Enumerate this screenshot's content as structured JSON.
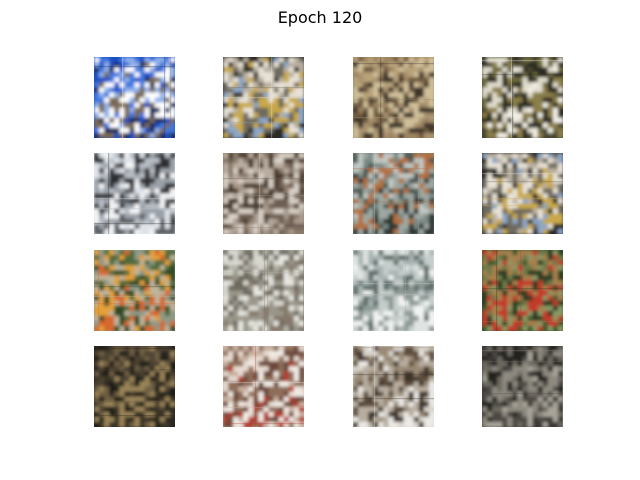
{
  "figure": {
    "title": "Epoch 120"
  },
  "samples": [
    {
      "row": 1,
      "col": 1,
      "palette": [
        "#1b4fc4",
        "#3f77e0",
        "#8fb0e8",
        "#ffffff",
        "#7a6a55",
        "#1a2a5c"
      ]
    },
    {
      "row": 1,
      "col": 2,
      "palette": [
        "#2c2a28",
        "#b9b0a0",
        "#e8e2d6",
        "#6e6a5e",
        "#c8a84a",
        "#8aa6c8"
      ]
    },
    {
      "row": 1,
      "col": 3,
      "palette": [
        "#9c8460",
        "#b8a27a",
        "#6e5a40",
        "#d0c09a",
        "#3e342a",
        "#a89270"
      ]
    },
    {
      "row": 1,
      "col": 4,
      "palette": [
        "#4a4630",
        "#6e6a3c",
        "#e0dccd",
        "#2a2a22",
        "#8a7e4a",
        "#f2efe6"
      ]
    },
    {
      "row": 2,
      "col": 1,
      "palette": [
        "#dfe4ea",
        "#b8bec6",
        "#2e2e30",
        "#9aa0a8",
        "#f4f5f7",
        "#5a5e64"
      ]
    },
    {
      "row": 2,
      "col": 2,
      "palette": [
        "#8a7a6a",
        "#b9ada0",
        "#4a3a2e",
        "#d8d0c6",
        "#6e5e52",
        "#a89a8c"
      ]
    },
    {
      "row": 2,
      "col": 3,
      "palette": [
        "#7a8a86",
        "#c2c8c4",
        "#4e5a52",
        "#b4703e",
        "#9ea8a2",
        "#2e3430"
      ]
    },
    {
      "row": 2,
      "col": 4,
      "palette": [
        "#2c2a28",
        "#b9b0a0",
        "#e8e2d6",
        "#6e6a5e",
        "#c8a84a",
        "#8aa6c8"
      ]
    },
    {
      "row": 3,
      "col": 1,
      "palette": [
        "#8e9a86",
        "#4f6a3a",
        "#e3a03a",
        "#c0b49a",
        "#2f4a26",
        "#d6682e"
      ]
    },
    {
      "row": 3,
      "col": 2,
      "palette": [
        "#b4b4aa",
        "#d8d8d0",
        "#6e6a60",
        "#9a968a",
        "#e8e8e2",
        "#84786a"
      ]
    },
    {
      "row": 3,
      "col": 3,
      "palette": [
        "#dfe4e2",
        "#a8b4b2",
        "#5e6e6a",
        "#c6cecc",
        "#8e9a96",
        "#f2f4f2"
      ]
    },
    {
      "row": 3,
      "col": 4,
      "palette": [
        "#3c5a2e",
        "#6e7a4a",
        "#a8804e",
        "#2a3a20",
        "#c23a2a",
        "#8a9a66"
      ]
    },
    {
      "row": 4,
      "col": 1,
      "palette": [
        "#2a2620",
        "#4e4232",
        "#6e5e42",
        "#1c1a16",
        "#9a8458",
        "#3a3428"
      ]
    },
    {
      "row": 4,
      "col": 2,
      "palette": [
        "#c8b0a0",
        "#e8dcd2",
        "#8e6e5a",
        "#6e4a3a",
        "#f2ece6",
        "#b43a2e"
      ]
    },
    {
      "row": 4,
      "col": 3,
      "palette": [
        "#d8d4cc",
        "#9a8a76",
        "#5e4e3e",
        "#b8aea0",
        "#3e342c",
        "#eceae6"
      ]
    },
    {
      "row": 4,
      "col": 4,
      "palette": [
        "#3a3834",
        "#6e6a62",
        "#24221e",
        "#8e8a80",
        "#4e4a44",
        "#a8a49a"
      ]
    }
  ]
}
